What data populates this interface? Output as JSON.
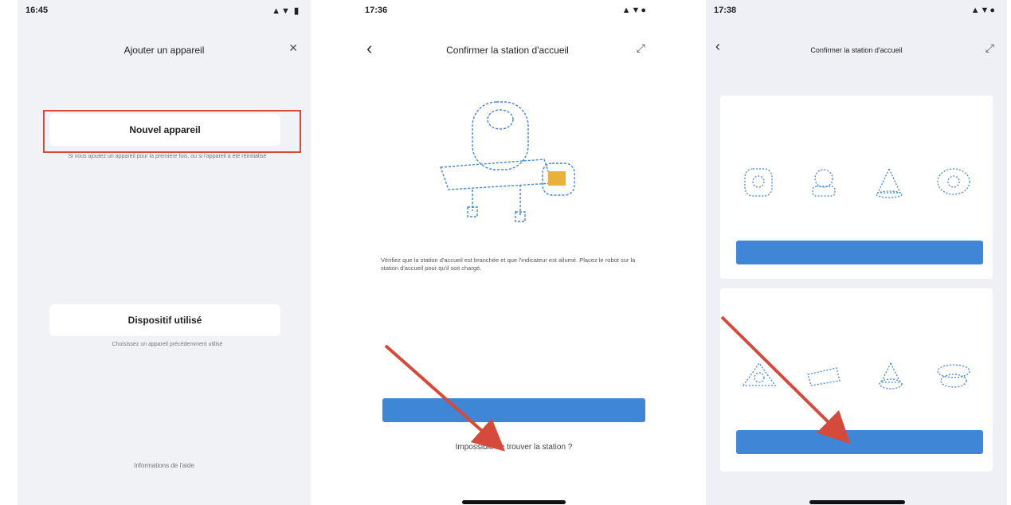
{
  "panel1": {
    "status_time": "16:45",
    "status_icons": "▲▼ ▮",
    "title": "Ajouter un appareil",
    "new_device": "Nouvel appareil",
    "new_device_desc": "Si vous ajoutez un appareil pour la première fois, ou si l'appareil a été réinitialisé",
    "used_device": "Dispositif utilisé",
    "used_device_desc": "Choisissez un appareil précédemment utilisé",
    "footer": "Informations de l'aide"
  },
  "panel2": {
    "status_time": "17:36",
    "title": "Confirmer la station d'accueil",
    "instructions": "Vérifiez que la station d'accueil est branchée et que l'indicateur est allumé. Placez le robot sur la station d'accueil pour qu'il soit chargé.",
    "primary_button": "",
    "secondary_link": "Impossible de trouver la station ?"
  },
  "panel3": {
    "status_time": "17:38",
    "title": "Confirmer la station d'accueil",
    "intro": "",
    "card1_title": "",
    "card1_button": "",
    "card2_title": "",
    "card2_button": "",
    "footer_text": ""
  },
  "colors": {
    "accent": "#3f87d6",
    "annotation": "#d64a3c"
  }
}
